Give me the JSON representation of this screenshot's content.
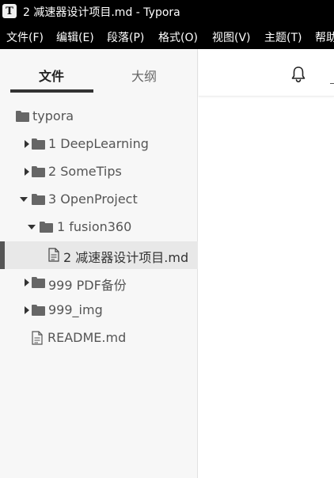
{
  "window": {
    "app_icon_letter": "T",
    "title": "2 减速器设计项目.md - Typora"
  },
  "menubar": {
    "items": [
      "文件(F)",
      "编辑(E)",
      "段落(P)",
      "格式(O)",
      "视图(V)",
      "主题(T)",
      "帮助"
    ]
  },
  "sidebar": {
    "tabs": {
      "files": "文件",
      "outline": "大纲",
      "active": "files"
    },
    "tree": [
      {
        "label": "typora",
        "type": "folder",
        "expanded": true,
        "depth": 0
      },
      {
        "label": "1 DeepLearning",
        "type": "folder",
        "expanded": false,
        "depth": 1
      },
      {
        "label": "2 SomeTips",
        "type": "folder",
        "expanded": false,
        "depth": 1
      },
      {
        "label": "3 OpenProject",
        "type": "folder",
        "expanded": true,
        "depth": 1
      },
      {
        "label": "1 fusion360",
        "type": "folder",
        "expanded": true,
        "depth": 2
      },
      {
        "label": "2 减速器设计项目.md",
        "type": "file",
        "selected": true,
        "depth": 3
      },
      {
        "label": "999 PDF备份",
        "type": "folder",
        "expanded": false,
        "depth": 1
      },
      {
        "label": "999_img",
        "type": "folder",
        "expanded": false,
        "depth": 1
      },
      {
        "label": "README.md",
        "type": "file",
        "depth": 1
      }
    ]
  },
  "main": {
    "toolbar_icons": [
      "bell-icon"
    ]
  },
  "colors": {
    "titlebar_bg": "#000000",
    "sidebar_bg": "#f7f7f7",
    "selected_row_bg": "#e8e8e8",
    "icon_gray": "#666666",
    "text_gray": "#555555"
  }
}
